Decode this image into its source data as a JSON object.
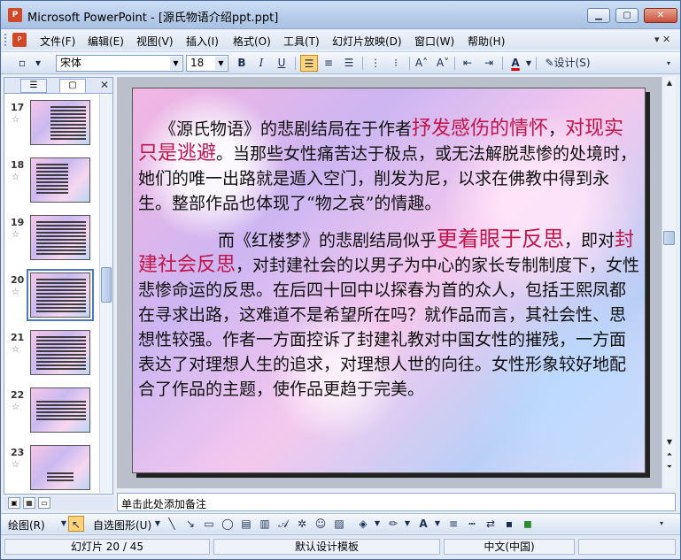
{
  "window": {
    "title": "Microsoft PowerPoint - [源氏物语介绍ppt.ppt]",
    "app_icon_letter": "P",
    "buttons": {
      "minimize": "▁",
      "maximize": "▢",
      "close": "✕"
    }
  },
  "menu": {
    "items": [
      "文件(F)",
      "编辑(E)",
      "视图(V)",
      "插入(I)",
      "格式(O)",
      "工具(T)",
      "幻灯片放映(D)",
      "窗口(W)",
      "帮助(H)"
    ],
    "doc_controls": "▾ ✕"
  },
  "toolbar": {
    "font_name": "宋体",
    "font_size": "18",
    "bold": "B",
    "italic": "I",
    "underline": "U",
    "design_label": "设计(S)",
    "font_color_label": "A"
  },
  "left_pane": {
    "tab_outline_icon": "outline-icon",
    "tab_slides_icon": "slides-icon",
    "close": "✕",
    "slides": [
      {
        "number": "17",
        "selected": false
      },
      {
        "number": "18",
        "selected": false
      },
      {
        "number": "19",
        "selected": false
      },
      {
        "number": "20",
        "selected": true
      },
      {
        "number": "21",
        "selected": false
      },
      {
        "number": "22",
        "selected": false
      },
      {
        "number": "23",
        "selected": false
      }
    ],
    "star": "☆"
  },
  "slide": {
    "para1": {
      "t1": "《源氏物语》的悲剧结局在于作者",
      "h1": "抒发感伤的情怀",
      "t2": "，",
      "h2": "对现实只是逃避",
      "t3": "。当那些女性痛苦达于极点，或无法解脱悲惨的处境时，她们的唯一出路就是遁入空门，削发为尼，以求在佛教中得到永生。整部作品也体现了“物之哀”的情趣。"
    },
    "para2": {
      "t1": "而《红楼梦》的悲剧结局似乎",
      "h1": "更着眼于反思",
      "t2": "，即对",
      "h2": "封建社会反思",
      "t3": "，对封建社会的以男子为中心的家长专制制度下，女性悲惨命运的反思。在后四十回中以探春为首的众人，包括王熙凤都在寻求出路，这难道不是希望所在吗？就作品而言，其社会性、思想性较强。作者一方面控诉了封建礼教对中国女性的摧残，一方面表达了对理想人生的追求，对理想人世的向往。女性形象较好地配合了作品的主题，使作品更趋于完美。"
    }
  },
  "notes": {
    "placeholder": "单击此处添加备注"
  },
  "drawbar": {
    "draw_label": "绘图(R)",
    "autoshape_label": "自选图形(U)"
  },
  "status": {
    "slide_info": "幻灯片 20 / 45",
    "template": "默认设计模板",
    "language": "中文(中国)"
  },
  "colors": {
    "highlight": "#c0144a",
    "accent": "#ffd37a"
  }
}
